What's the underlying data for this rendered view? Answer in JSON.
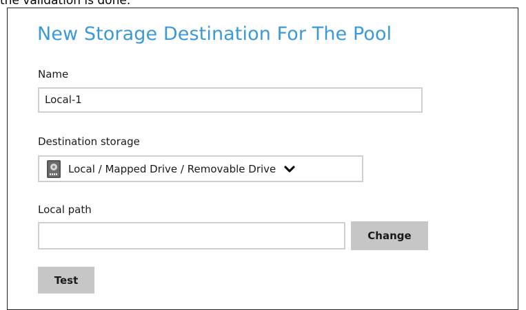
{
  "doc": {
    "caption": "the validation is done."
  },
  "form": {
    "title": "New Storage Destination For The Pool",
    "name_label": "Name",
    "name_value": "Local-1",
    "destination_label": "Destination storage",
    "destination_value": "Local / Mapped Drive / Removable Drive",
    "destination_icon": "drive-icon",
    "local_path_label": "Local path",
    "local_path_value": "",
    "change_label": "Change",
    "test_label": "Test"
  },
  "colors": {
    "title": "#3a9ad9",
    "button_bg": "#c6c6c6",
    "input_border": "#cfcfcf"
  }
}
